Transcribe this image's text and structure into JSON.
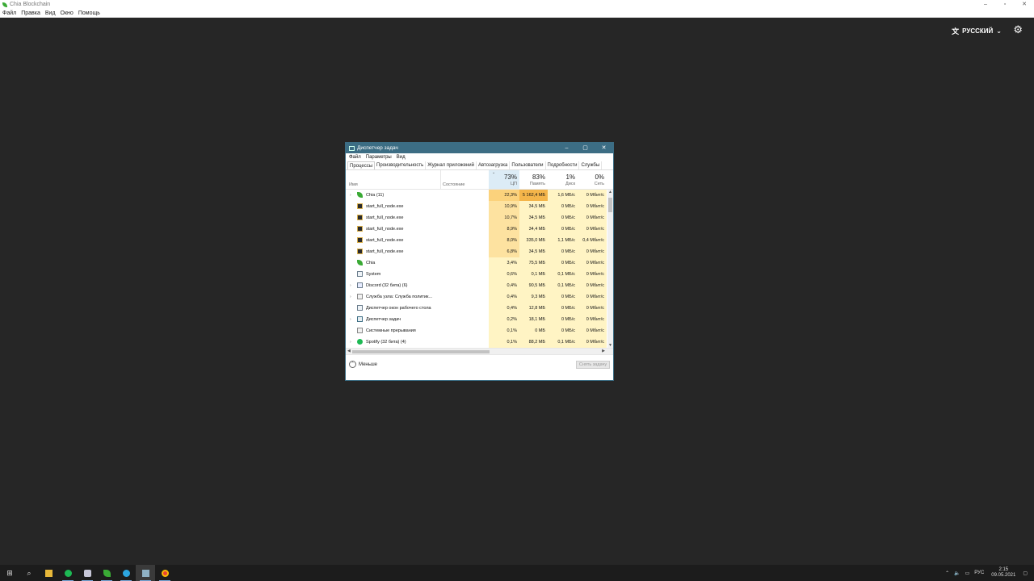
{
  "app": {
    "title": "Chia Blockchain",
    "menu": [
      "Файл",
      "Правка",
      "Вид",
      "Окно",
      "Помощь"
    ],
    "window_buttons": [
      "–",
      "▫",
      "✕"
    ],
    "language": "РУССКИЙ"
  },
  "task_manager": {
    "title": "Диспетчер задач",
    "menu": [
      "Файл",
      "Параметры",
      "Вид"
    ],
    "tabs": [
      "Процессы",
      "Производительность",
      "Журнал приложений",
      "Автозагрузка",
      "Пользователи",
      "Подробности",
      "Службы"
    ],
    "active_tab": "Процессы",
    "columns": {
      "name": "Имя",
      "state": "Состояние",
      "cpu": {
        "pct": "73%",
        "label": "ЦП"
      },
      "memory": {
        "pct": "83%",
        "label": "Память"
      },
      "disk": {
        "pct": "1%",
        "label": "Диск"
      },
      "network": {
        "pct": "0%",
        "label": "Сеть"
      }
    },
    "rows": [
      {
        "name": "Chia (11)",
        "expand": true,
        "icon": "leaf",
        "cpu": "22,3%",
        "mem": "5 162,4 МБ",
        "disk": "1,6 МБ/с",
        "net": "0 Мбит/с"
      },
      {
        "name": "start_full_node.exe",
        "expand": false,
        "icon": "app",
        "cpu": "10,9%",
        "mem": "34,5 МБ",
        "disk": "0 МБ/с",
        "net": "0 Мбит/с"
      },
      {
        "name": "start_full_node.exe",
        "expand": false,
        "icon": "app",
        "cpu": "10,7%",
        "mem": "34,5 МБ",
        "disk": "0 МБ/с",
        "net": "0 Мбит/с"
      },
      {
        "name": "start_full_node.exe",
        "expand": false,
        "icon": "app",
        "cpu": "8,9%",
        "mem": "34,4 МБ",
        "disk": "0 МБ/с",
        "net": "0 Мбит/с"
      },
      {
        "name": "start_full_node.exe",
        "expand": false,
        "icon": "app",
        "cpu": "8,0%",
        "mem": "335,0 МБ",
        "disk": "1,1 МБ/с",
        "net": "0,4 Мбит/с"
      },
      {
        "name": "start_full_node.exe",
        "expand": false,
        "icon": "app",
        "cpu": "6,8%",
        "mem": "34,5 МБ",
        "disk": "0 МБ/с",
        "net": "0 Мбит/с"
      },
      {
        "name": "Chia",
        "expand": false,
        "icon": "leaf",
        "cpu": "3,4%",
        "mem": "75,5 МБ",
        "disk": "0 МБ/с",
        "net": "0 Мбит/с"
      },
      {
        "name": "System",
        "expand": false,
        "icon": "sys",
        "cpu": "0,6%",
        "mem": "0,1 МБ",
        "disk": "0,1 МБ/с",
        "net": "0 Мбит/с"
      },
      {
        "name": "Discord (32 бита) (6)",
        "expand": true,
        "icon": "disc",
        "cpu": "0,4%",
        "mem": "90,5 МБ",
        "disk": "0,1 МБ/с",
        "net": "0 Мбит/с"
      },
      {
        "name": "Служба узла: Служба политик...",
        "expand": true,
        "icon": "svc",
        "cpu": "0,4%",
        "mem": "9,3 МБ",
        "disk": "0 МБ/с",
        "net": "0 Мбит/с"
      },
      {
        "name": "Диспетчер окон рабочего стола",
        "expand": false,
        "icon": "sys",
        "cpu": "0,4%",
        "mem": "12,8 МБ",
        "disk": "0 МБ/с",
        "net": "0 Мбит/с"
      },
      {
        "name": "Диспетчер задач",
        "expand": true,
        "icon": "tm2",
        "cpu": "0,2%",
        "mem": "18,1 МБ",
        "disk": "0 МБ/с",
        "net": "0 Мбит/с"
      },
      {
        "name": "Системные прерывания",
        "expand": false,
        "icon": "svc",
        "cpu": "0,1%",
        "mem": "0 МБ",
        "disk": "0 МБ/с",
        "net": "0 Мбит/с"
      },
      {
        "name": "Spotify (32 бита) (4)",
        "expand": true,
        "icon": "spot",
        "cpu": "0,1%",
        "mem": "88,2 МБ",
        "disk": "0,1 МБ/с",
        "net": "0 Мбит/с"
      }
    ],
    "less_label": "Меньше",
    "end_task_label": "Снять задачу",
    "colors": {
      "titlebar": "#3c6d84",
      "cpu_hot": "#fbd27c",
      "mem_hot": "#f4b54a",
      "cell_light": "#fff4c4"
    }
  },
  "taskbar": {
    "tray": {
      "lang": "РУС",
      "time": "2:15",
      "date": "09.05.2021"
    }
  }
}
